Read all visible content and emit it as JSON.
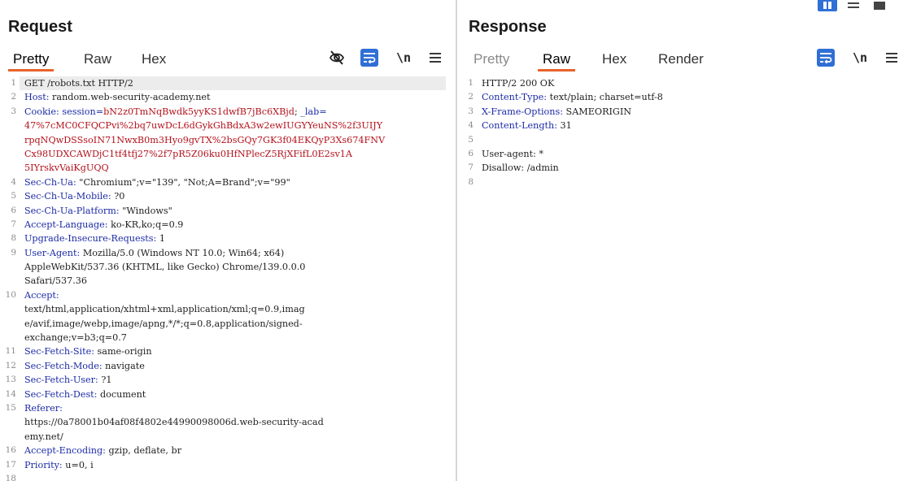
{
  "request": {
    "title": "Request",
    "tabs": [
      "Pretty",
      "Raw",
      "Hex"
    ],
    "active_tab": "Pretty",
    "icons": [
      "eye-off-icon",
      "word-wrap-icon",
      "newline-icon",
      "menu-icon"
    ],
    "newline_label": "\\n",
    "lines": [
      {
        "n": "1",
        "parts": [
          {
            "t": "GET /robots.txt HTTP/2",
            "c": "hs"
          }
        ],
        "hl": true
      },
      {
        "n": "2",
        "parts": [
          {
            "t": "Host:",
            "c": "hk"
          },
          {
            "t": " random.web-security-academy.net",
            "c": "hs"
          }
        ]
      },
      {
        "n": "3",
        "parts": [
          {
            "t": "Cookie:",
            "c": "hk"
          },
          {
            "t": " session=",
            "c": "hk"
          },
          {
            "t": "bN2z0TmNqBwdk5yyKS1dwfB7jBc6XBjd",
            "c": "cv"
          },
          {
            "t": "; ",
            "c": "hs"
          },
          {
            "t": "_lab=",
            "c": "hk"
          }
        ]
      },
      {
        "n": "",
        "parts": [
          {
            "t": "47%7cMC0CFQCPvi%2bq7uwDcL6dGykGhBdxA3w2ewIUGYYeuNS%2f3UIJY",
            "c": "cv"
          }
        ]
      },
      {
        "n": "",
        "parts": [
          {
            "t": "rpqNQwDSSsoIN71NwxB0m3Hyo9gvTX%2bsGQy7GK3f04EKQyP3Xs674FNV",
            "c": "cv"
          }
        ]
      },
      {
        "n": "",
        "parts": [
          {
            "t": "Cx98UDXCAWDjC1tf4tfj27%2f7pR5Z06ku0HfNPlecZ5RjXFifL0E2sv1A",
            "c": "cv"
          }
        ]
      },
      {
        "n": "",
        "parts": [
          {
            "t": "5IYrskvVaiKgUQQ",
            "c": "cv"
          }
        ]
      },
      {
        "n": "4",
        "parts": [
          {
            "t": "Sec-Ch-Ua:",
            "c": "hk"
          },
          {
            "t": " \"Chromium\";v=\"139\", \"Not;A=Brand\";v=\"99\"",
            "c": "hs"
          }
        ]
      },
      {
        "n": "5",
        "parts": [
          {
            "t": "Sec-Ch-Ua-Mobile:",
            "c": "hk"
          },
          {
            "t": " ?0",
            "c": "hs"
          }
        ]
      },
      {
        "n": "6",
        "parts": [
          {
            "t": "Sec-Ch-Ua-Platform:",
            "c": "hk"
          },
          {
            "t": " \"Windows\"",
            "c": "hs"
          }
        ]
      },
      {
        "n": "7",
        "parts": [
          {
            "t": "Accept-Language:",
            "c": "hk"
          },
          {
            "t": " ko-KR,ko;q=0.9",
            "c": "hs"
          }
        ]
      },
      {
        "n": "8",
        "parts": [
          {
            "t": "Upgrade-Insecure-Requests:",
            "c": "hk"
          },
          {
            "t": " 1",
            "c": "hs"
          }
        ]
      },
      {
        "n": "9",
        "parts": [
          {
            "t": "User-Agent:",
            "c": "hk"
          },
          {
            "t": " Mozilla/5.0 (Windows NT 10.0; Win64; x64)",
            "c": "hs"
          }
        ]
      },
      {
        "n": "",
        "parts": [
          {
            "t": "AppleWebKit/537.36 (KHTML, like Gecko) Chrome/139.0.0.0",
            "c": "hs"
          }
        ]
      },
      {
        "n": "",
        "parts": [
          {
            "t": "Safari/537.36",
            "c": "hs"
          }
        ]
      },
      {
        "n": "10",
        "parts": [
          {
            "t": "Accept:",
            "c": "hk"
          }
        ]
      },
      {
        "n": "",
        "parts": [
          {
            "t": "text/html,application/xhtml+xml,application/xml;q=0.9,imag",
            "c": "hs"
          }
        ]
      },
      {
        "n": "",
        "parts": [
          {
            "t": "e/avif,image/webp,image/apng,*/*;q=0.8,application/signed-",
            "c": "hs"
          }
        ]
      },
      {
        "n": "",
        "parts": [
          {
            "t": "exchange;v=b3;q=0.7",
            "c": "hs"
          }
        ]
      },
      {
        "n": "11",
        "parts": [
          {
            "t": "Sec-Fetch-Site:",
            "c": "hk"
          },
          {
            "t": " same-origin",
            "c": "hs"
          }
        ]
      },
      {
        "n": "12",
        "parts": [
          {
            "t": "Sec-Fetch-Mode:",
            "c": "hk"
          },
          {
            "t": " navigate",
            "c": "hs"
          }
        ]
      },
      {
        "n": "13",
        "parts": [
          {
            "t": "Sec-Fetch-User:",
            "c": "hk"
          },
          {
            "t": " ?1",
            "c": "hs"
          }
        ]
      },
      {
        "n": "14",
        "parts": [
          {
            "t": "Sec-Fetch-Dest:",
            "c": "hk"
          },
          {
            "t": " document",
            "c": "hs"
          }
        ]
      },
      {
        "n": "15",
        "parts": [
          {
            "t": "Referer:",
            "c": "hk"
          }
        ]
      },
      {
        "n": "",
        "parts": [
          {
            "t": "https://0a78001b04af08f4802e44990098006d.web-security-acad",
            "c": "hs"
          }
        ]
      },
      {
        "n": "",
        "parts": [
          {
            "t": "emy.net/",
            "c": "hs"
          }
        ]
      },
      {
        "n": "16",
        "parts": [
          {
            "t": "Accept-Encoding:",
            "c": "hk"
          },
          {
            "t": " gzip, deflate, br",
            "c": "hs"
          }
        ]
      },
      {
        "n": "17",
        "parts": [
          {
            "t": "Priority:",
            "c": "hk"
          },
          {
            "t": " u=0, i",
            "c": "hs"
          }
        ]
      },
      {
        "n": "18",
        "parts": []
      }
    ]
  },
  "response": {
    "title": "Response",
    "tabs": [
      "Pretty",
      "Raw",
      "Hex",
      "Render"
    ],
    "active_tab": "Raw",
    "icons": [
      "word-wrap-icon",
      "newline-icon",
      "menu-icon"
    ],
    "newline_label": "\\n",
    "lines": [
      {
        "n": "1",
        "parts": [
          {
            "t": "HTTP/2 200 OK",
            "c": "hs"
          }
        ]
      },
      {
        "n": "2",
        "parts": [
          {
            "t": "Content-Type:",
            "c": "hk"
          },
          {
            "t": " text/plain; charset=utf-8",
            "c": "hs"
          }
        ]
      },
      {
        "n": "3",
        "parts": [
          {
            "t": "X-Frame-Options:",
            "c": "hk"
          },
          {
            "t": " SAMEORIGIN",
            "c": "hs"
          }
        ]
      },
      {
        "n": "4",
        "parts": [
          {
            "t": "Content-Length:",
            "c": "hk"
          },
          {
            "t": " 31",
            "c": "hs"
          }
        ]
      },
      {
        "n": "5",
        "parts": []
      },
      {
        "n": "6",
        "parts": [
          {
            "t": "User-agent: *",
            "c": "hs"
          }
        ]
      },
      {
        "n": "7",
        "parts": [
          {
            "t": "Disallow: /admin",
            "c": "hs"
          }
        ]
      },
      {
        "n": "8",
        "parts": []
      }
    ]
  },
  "layout_buttons": [
    "split-vertical-icon",
    "split-horizontal-icon",
    "tabs-layout-icon"
  ],
  "colors": {
    "accent": "#e8632b",
    "header_key": "#1c2ba6",
    "cookie_value": "#b3121c",
    "active_button": "#2f6fd6"
  }
}
